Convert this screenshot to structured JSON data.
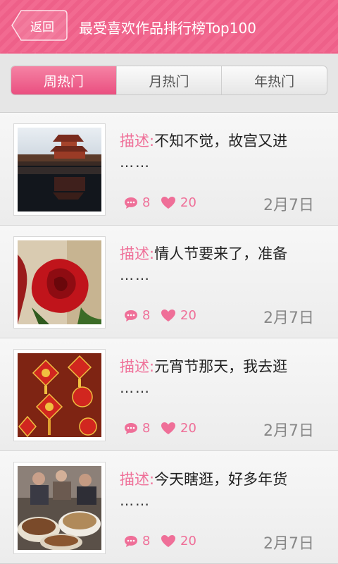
{
  "header": {
    "back_label": "返回",
    "title": "最受喜欢作品排行榜Top100"
  },
  "tabs": [
    {
      "label": "周热门",
      "active": true
    },
    {
      "label": "月热门",
      "active": false
    },
    {
      "label": "年热门",
      "active": false
    }
  ],
  "colors": {
    "accent": "#ef6f98",
    "header": "#f26a91"
  },
  "items": [
    {
      "desc_label": "描述:",
      "desc_text": "不知不觉，故宫又进",
      "ellipsis": "……",
      "comments": "8",
      "likes": "20",
      "date": "2月7日",
      "image": "forbidden-city-photo"
    },
    {
      "desc_label": "描述:",
      "desc_text": "情人节要来了，准备",
      "ellipsis": "……",
      "comments": "8",
      "likes": "20",
      "date": "2月7日",
      "image": "red-rose-photo"
    },
    {
      "desc_label": "描述:",
      "desc_text": "元宵节那天，我去逛",
      "ellipsis": "……",
      "comments": "8",
      "likes": "20",
      "date": "2月7日",
      "image": "lantern-festival-photo"
    },
    {
      "desc_label": "描述:",
      "desc_text": "今天瞎逛，好多年货",
      "ellipsis": "……",
      "comments": "8",
      "likes": "20",
      "date": "2月7日",
      "image": "market-goods-photo"
    }
  ]
}
